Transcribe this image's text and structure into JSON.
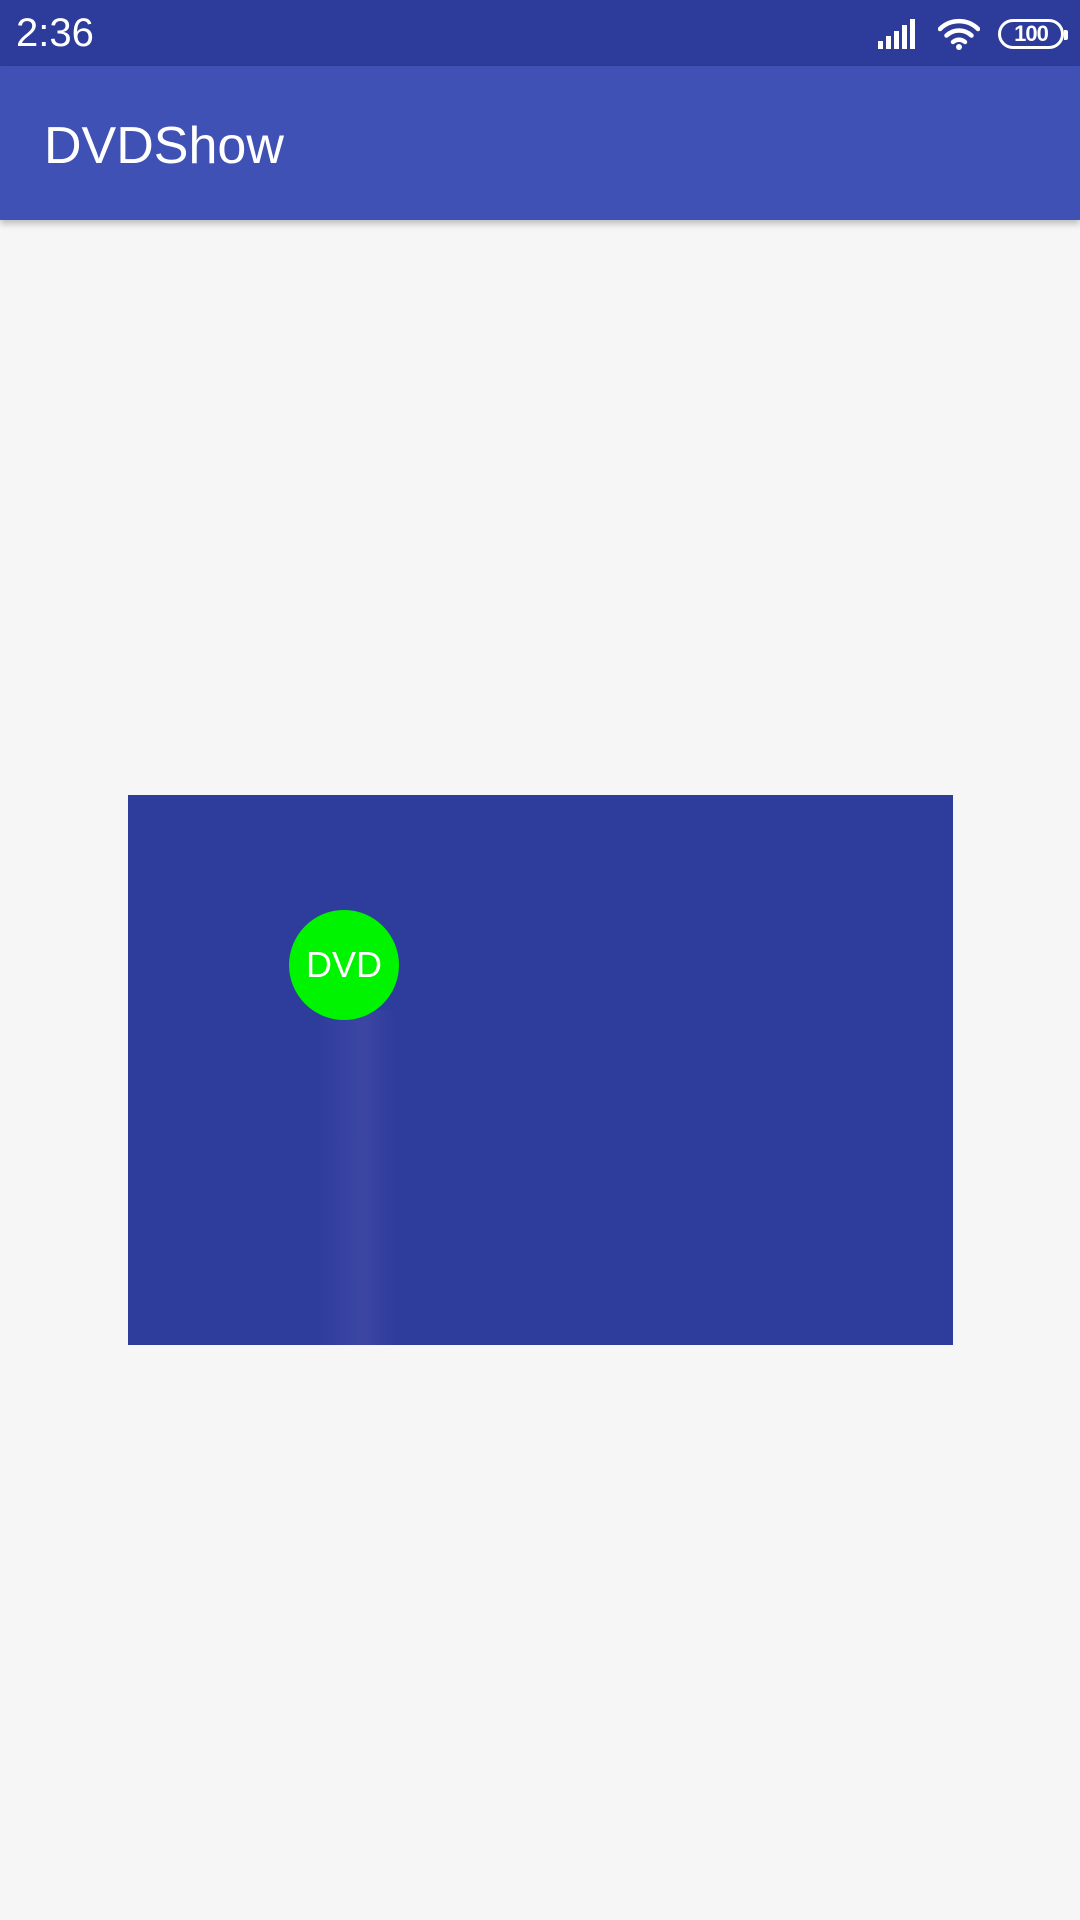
{
  "status_bar": {
    "time": "2:36",
    "battery_level": "100",
    "icons": [
      "signal-icon",
      "wifi-icon",
      "battery-icon"
    ],
    "background_color": "#2d3b9a"
  },
  "app_bar": {
    "title": "DVDShow",
    "background_color": "#3f51b5"
  },
  "canvas": {
    "background_color": "#2e3c9b",
    "logo": {
      "label": "DVD",
      "color": "#00f400"
    }
  },
  "page": {
    "background_color": "#f5f6f5"
  }
}
